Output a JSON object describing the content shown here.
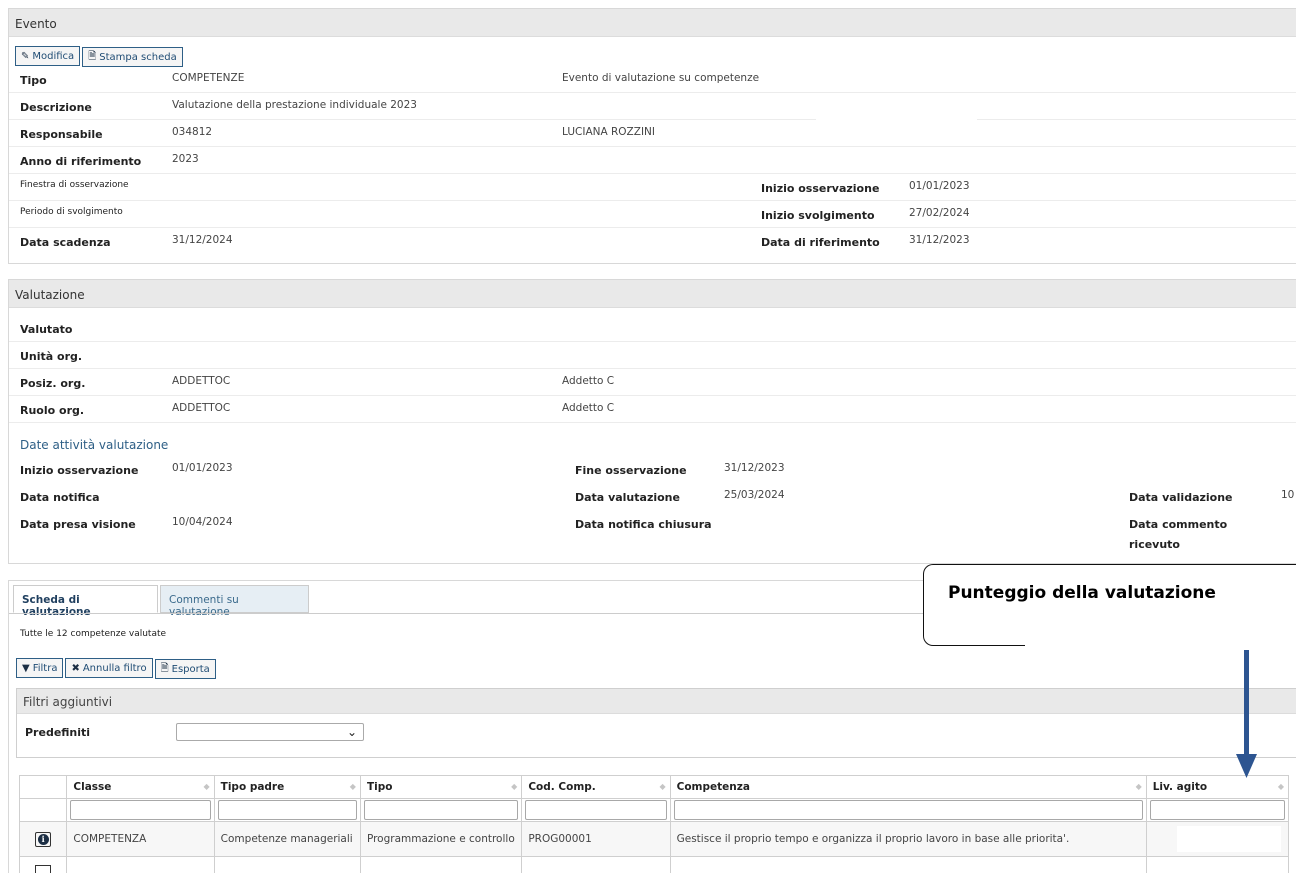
{
  "evento": {
    "title": "Evento",
    "buttons": {
      "modifica": "Modifica",
      "stampa": "Stampa scheda"
    },
    "fields": {
      "tipo_label": "Tipo",
      "tipo_value": "COMPETENZE",
      "tipo_desc": "Evento di valutazione su competenze",
      "descrizione_label": "Descrizione",
      "descrizione_value": "Valutazione della prestazione individuale 2023",
      "responsabile_label": "Responsabile",
      "responsabile_code": "034812",
      "responsabile_name": "LUCIANA ROZZINI",
      "anno_label": "Anno di riferimento",
      "anno_value": "2023",
      "finestra_label": "Finestra di osservazione",
      "inizio_oss_label": "Inizio osservazione",
      "inizio_oss_value": "01/01/2023",
      "periodo_label": "Periodo di svolgimento",
      "inizio_svolg_label": "Inizio svolgimento",
      "inizio_svolg_value": "27/02/2024",
      "scadenza_label": "Data scadenza",
      "scadenza_value": "31/12/2024",
      "data_rif_label": "Data di riferimento",
      "data_rif_value": "31/12/2023"
    }
  },
  "valutazione": {
    "title": "Valutazione",
    "fields": {
      "valutato_label": "Valutato",
      "unita_label": "Unità org.",
      "posiz_label": "Posiz. org.",
      "posiz_code": "ADDETTOC",
      "posiz_desc": "Addetto C",
      "ruolo_label": "Ruolo org.",
      "ruolo_code": "ADDETTOC",
      "ruolo_desc": "Addetto C"
    },
    "date_section_title": "Date attività valutazione",
    "dates": {
      "inizio_oss_label": "Inizio osservazione",
      "inizio_oss_value": "01/01/2023",
      "fine_oss_label": "Fine osservazione",
      "fine_oss_value": "31/12/2023",
      "notifica_label": "Data notifica",
      "data_valutazione_label": "Data valutazione",
      "data_valutazione_value": "25/03/2024",
      "data_validazione_label": "Data validazione",
      "data_validazione_value": "10",
      "presa_visione_label": "Data presa visione",
      "presa_visione_value": "10/04/2024",
      "notifica_chiusura_label": "Data notifica chiusura",
      "commento_label_1": "Data commento",
      "commento_label_2": "ricevuto"
    }
  },
  "scheda": {
    "tabs": [
      "Scheda di valutazione",
      "Commenti su valutazione"
    ],
    "summary": "Tutte le 12 competenze valutate",
    "buttons": {
      "filtra": "Filtra",
      "annulla": "Annulla filtro",
      "esporta": "Esporta"
    },
    "filtri_title": "Filtri aggiuntivi",
    "predefiniti_label": "Predefiniti",
    "columns": [
      "Classe",
      "Tipo padre",
      "Tipo",
      "Cod. Comp.",
      "Competenza",
      "Liv. agito"
    ],
    "rows": [
      [
        "COMPETENZA",
        "Competenze manageriali",
        "Programmazione e controllo",
        "PROG00001",
        "Gestisce il proprio tempo e organizza il proprio lavoro in base alle priorita'.",
        ""
      ]
    ]
  },
  "callout": {
    "text": "Punteggio della valutazione"
  },
  "colors": {
    "accent": "#2e5f86",
    "arrow": "#2d5591",
    "header_bg": "#e9e9e9"
  }
}
